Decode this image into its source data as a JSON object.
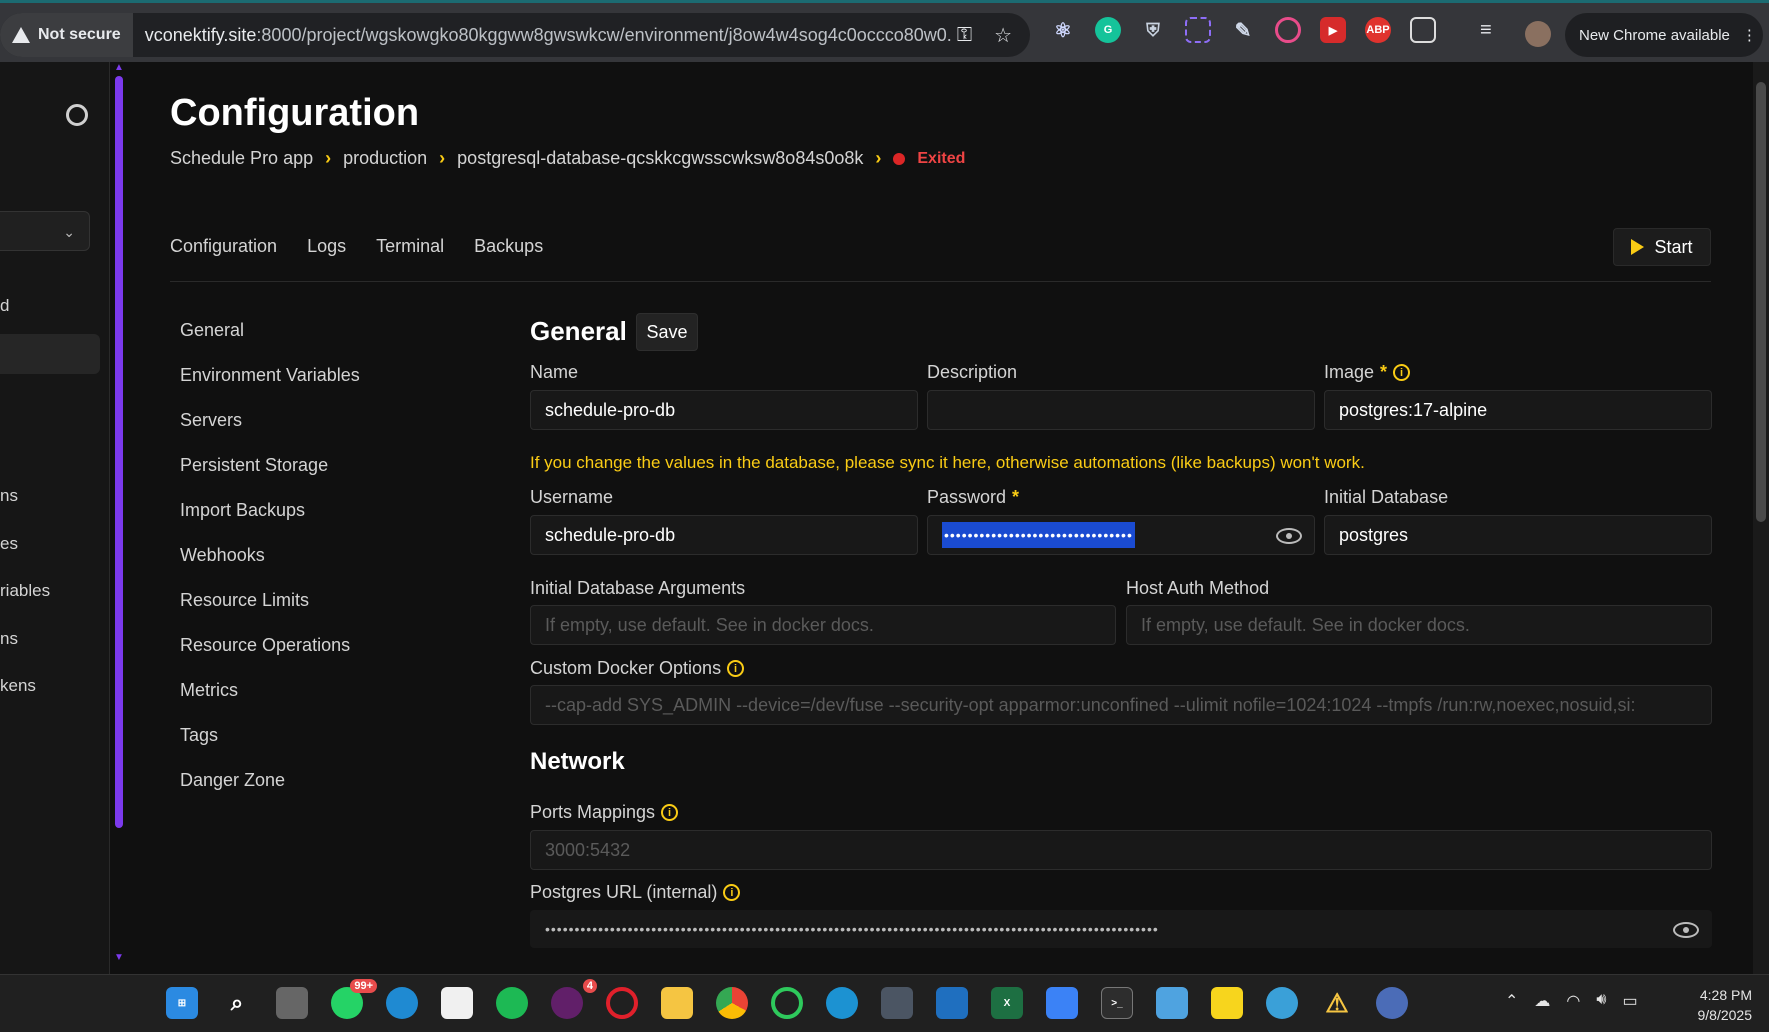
{
  "browser": {
    "security_label": "Not secure",
    "url_host": "vconektify.site",
    "url_rest": ":8000/project/wgskowgko80kggww8gwswkcw/environment/j8ow4w4sog4c0occco80w0...",
    "update_label": "New Chrome available",
    "extensions": [
      "react-devtools",
      "grammarly",
      "privacy-badger",
      "color-picker",
      "stylus",
      "extension-ring",
      "pdf-extension",
      "ABP",
      "puzzle"
    ]
  },
  "left_panel": {
    "items": [
      "d",
      "ns",
      "es",
      "riables",
      "ns",
      "kens"
    ]
  },
  "page": {
    "title": "Configuration",
    "breadcrumb": [
      "Schedule Pro app",
      "production",
      "postgresql-database-qcskkcgwsscwksw8o84s0o8k"
    ],
    "status": "Exited",
    "status_color": "#dc2626"
  },
  "tabs": [
    "Configuration",
    "Logs",
    "Terminal",
    "Backups"
  ],
  "start_label": "Start",
  "subnav": [
    "General",
    "Environment Variables",
    "Servers",
    "Persistent Storage",
    "Import Backups",
    "Webhooks",
    "Resource Limits",
    "Resource Operations",
    "Metrics",
    "Tags",
    "Danger Zone"
  ],
  "general": {
    "title": "General",
    "save_label": "Save",
    "name_label": "Name",
    "name_value": "schedule-pro-db",
    "description_label": "Description",
    "description_value": "",
    "image_label": "Image",
    "image_value": "postgres:17-alpine",
    "warning": "If you change the values in the database, please sync it here, otherwise automations (like backups) won't work.",
    "username_label": "Username",
    "username_value": "schedule-pro-db",
    "password_label": "Password",
    "password_mask": "••••••••••••••••••••••••••••••••",
    "initial_db_label": "Initial Database",
    "initial_db_value": "postgres",
    "init_args_label": "Initial Database Arguments",
    "init_args_placeholder": "If empty, use default. See in docker docs.",
    "host_auth_label": "Host Auth Method",
    "host_auth_placeholder": "If empty, use default. See in docker docs.",
    "docker_opts_label": "Custom Docker Options",
    "docker_opts_placeholder": "--cap-add SYS_ADMIN --device=/dev/fuse --security-opt apparmor:unconfined --ulimit nofile=1024:1024 --tmpfs /run:rw,noexec,nosuid,si:"
  },
  "network": {
    "title": "Network",
    "ports_label": "Ports Mappings",
    "ports_placeholder": "3000:5432",
    "pg_url_label": "Postgres URL (internal)",
    "pg_url_mask": "••••••••••••••••••••••••••••••••••••••••••••••••••••••••••••••••••••••••••••••••••••••••••••••••••••••••"
  },
  "taskbar": {
    "whatsapp_badge": "99+",
    "slack_badge": "4",
    "time": "4:28 PM",
    "date": "9/8/2025"
  },
  "colors": {
    "accent": "#7c3aed",
    "warning": "#facc15",
    "danger": "#dc2626"
  }
}
